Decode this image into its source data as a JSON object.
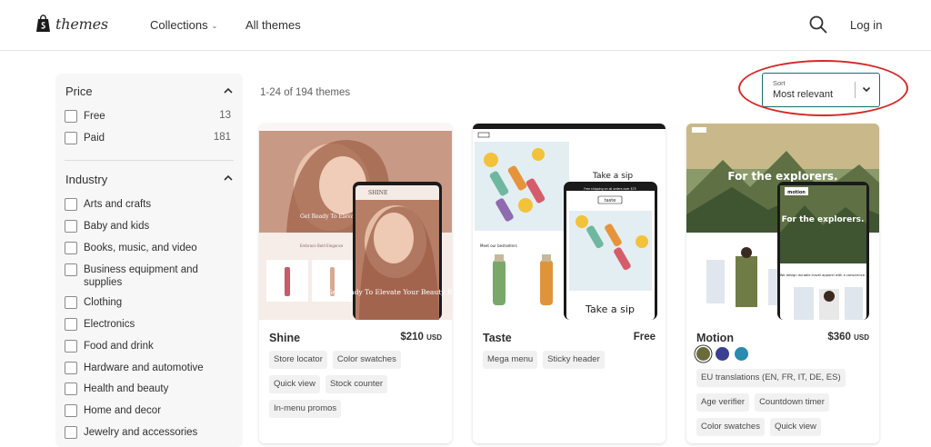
{
  "header": {
    "brand": "themes",
    "nav_collections": "Collections",
    "nav_all_themes": "All themes",
    "login": "Log in"
  },
  "filters": {
    "price": {
      "title": "Price",
      "options": [
        {
          "label": "Free",
          "count": "13"
        },
        {
          "label": "Paid",
          "count": "181"
        }
      ]
    },
    "industry": {
      "title": "Industry",
      "options": [
        {
          "label": "Arts and crafts"
        },
        {
          "label": "Baby and kids"
        },
        {
          "label": "Books, music, and video"
        },
        {
          "label": "Business equipment and supplies"
        },
        {
          "label": "Clothing"
        },
        {
          "label": "Electronics"
        },
        {
          "label": "Food and drink"
        },
        {
          "label": "Hardware and automotive"
        },
        {
          "label": "Health and beauty"
        },
        {
          "label": "Home and decor"
        },
        {
          "label": "Jewelry and accessories"
        }
      ]
    }
  },
  "results": {
    "count_text": "1-24 of 194 themes"
  },
  "sort": {
    "caption": "Sort",
    "value": "Most relevant"
  },
  "themes": [
    {
      "name": "Shine",
      "price": "$210",
      "currency": "USD",
      "tags": [
        "Store locator",
        "Color swatches",
        "Quick view",
        "Stock counter",
        "In-menu promos"
      ],
      "preview_text": {
        "brand": "SHINE",
        "hero": "Get Ready To Elevate Your Beauty Ritual",
        "hero_short": "Get Ready To Elevate",
        "section": "Embrace Bold Elegance"
      }
    },
    {
      "name": "Taste",
      "price": "Free",
      "currency": "",
      "tags": [
        "Mega menu",
        "Sticky header"
      ],
      "preview_text": {
        "logo": "taste",
        "announcement": "Free shipping on all orders over $75",
        "hero": "Take a sip",
        "section": "Meet our bestsellers"
      }
    },
    {
      "name": "Motion",
      "price": "$360",
      "currency": "USD",
      "tags": [
        "EU translations (EN, FR, IT, DE, ES)",
        "Age verifier",
        "Countdown timer",
        "Color swatches",
        "Quick view"
      ],
      "swatches": [
        "#6b6b3a",
        "#3b3f8f",
        "#2a8ab0"
      ],
      "preview_text": {
        "logo": "motion",
        "hero": "For the explorers.",
        "tagline": "We design durable travel apparel with a conscience."
      }
    }
  ]
}
